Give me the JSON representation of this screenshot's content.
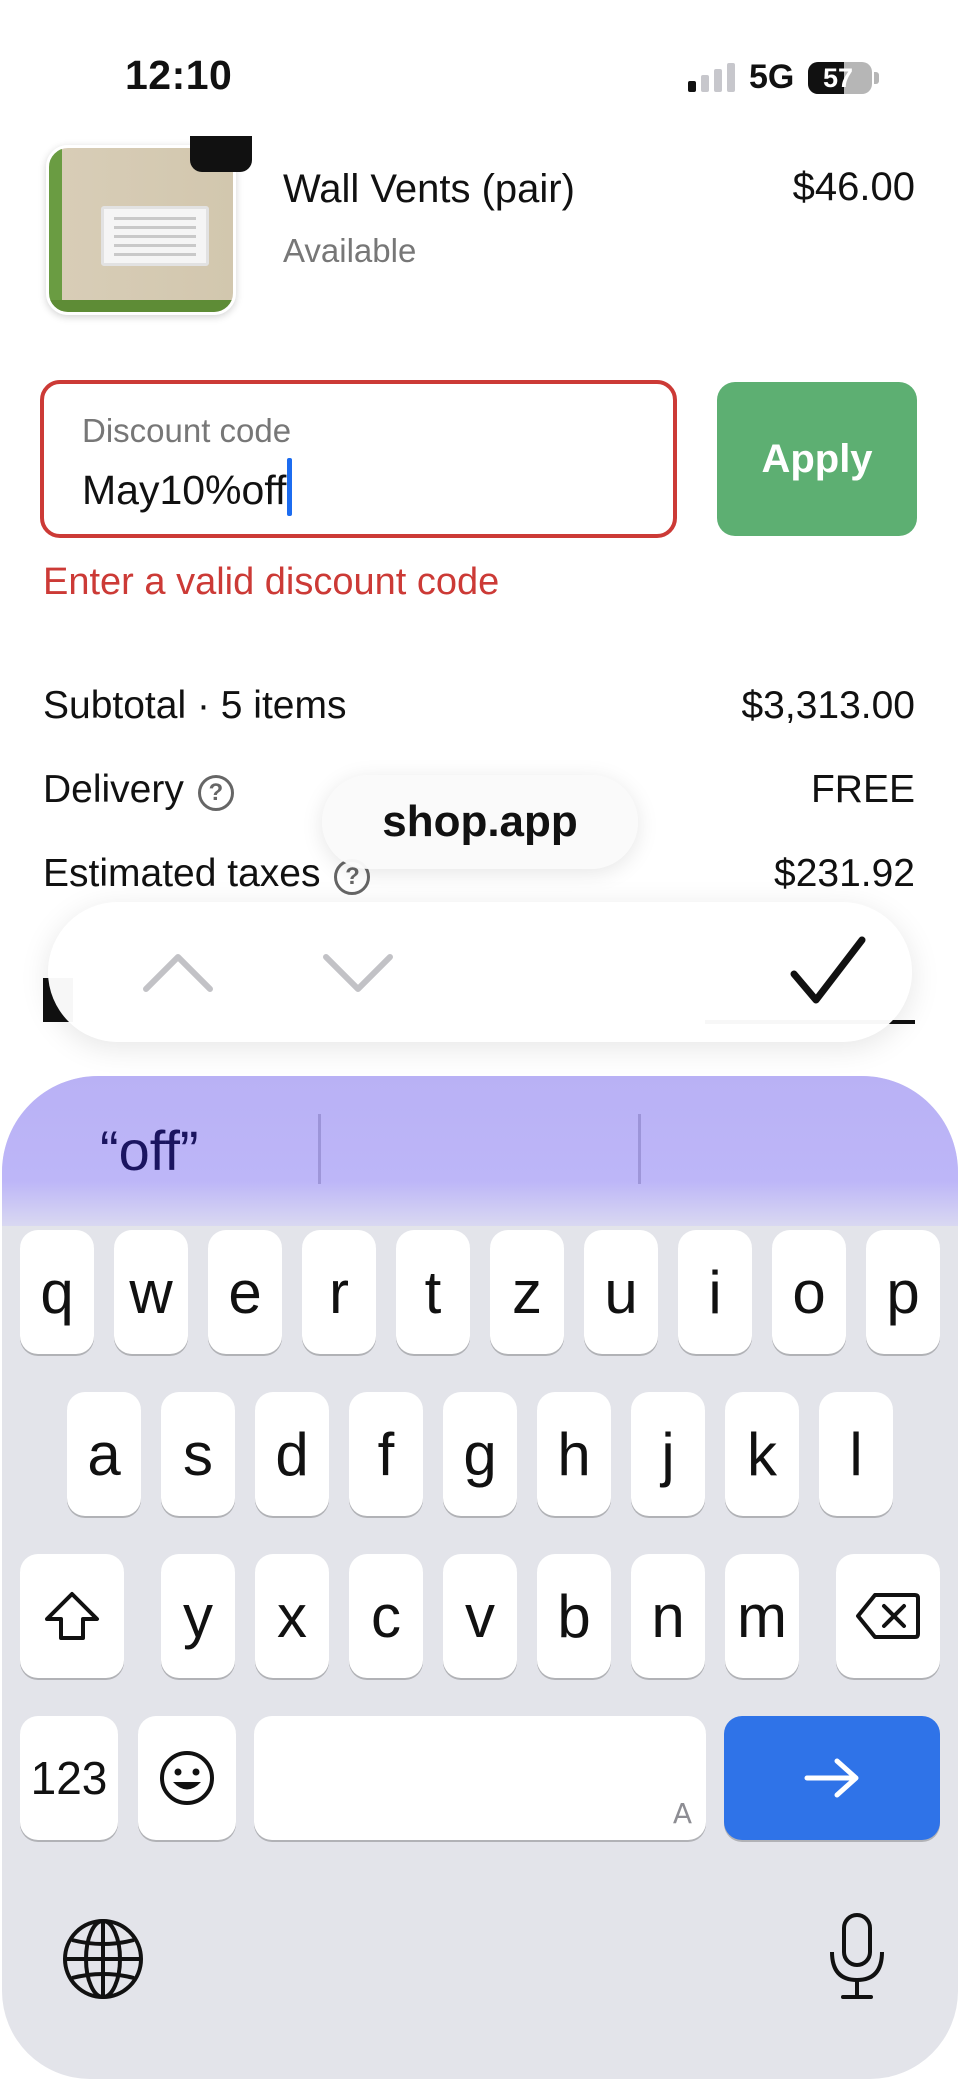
{
  "status_bar": {
    "time": "12:10",
    "network": "5G",
    "battery": "57",
    "battery_level": 0.57
  },
  "product": {
    "name": "Wall Vents (pair)",
    "availability": "Available",
    "price": "$46.00",
    "image_icon": "wall-vent-photo"
  },
  "discount": {
    "label": "Discount code",
    "value": "May10%off",
    "apply_label": "Apply",
    "error": "Enter a valid discount code"
  },
  "summary": {
    "subtotal_label": "Subtotal · 5 items",
    "subtotal_value": "$3,313.00",
    "delivery_label": "Delivery",
    "delivery_value": "FREE",
    "taxes_label": "Estimated taxes",
    "taxes_value": "$231.92",
    "help_icon": "?"
  },
  "browser": {
    "url": "shop.app"
  },
  "form_toolbar": {
    "previous_icon": "chevron-up-icon",
    "next_icon": "chevron-down-icon",
    "done_icon": "checkmark-icon"
  },
  "keyboard": {
    "suggestions": [
      "“off”",
      "",
      ""
    ],
    "row1": [
      "q",
      "w",
      "e",
      "r",
      "t",
      "z",
      "u",
      "i",
      "o",
      "p"
    ],
    "row2": [
      "a",
      "s",
      "d",
      "f",
      "g",
      "h",
      "j",
      "k",
      "l"
    ],
    "row3": [
      "y",
      "x",
      "c",
      "v",
      "b",
      "n",
      "m"
    ],
    "numbers_label": "123",
    "space_hint": "A",
    "return_color": "#2f73e8",
    "suggestion_color": "#bdb6f8"
  },
  "colors": {
    "error": "#cc3a36",
    "apply_button": "#5daf72",
    "caret": "#1c6cf0"
  }
}
